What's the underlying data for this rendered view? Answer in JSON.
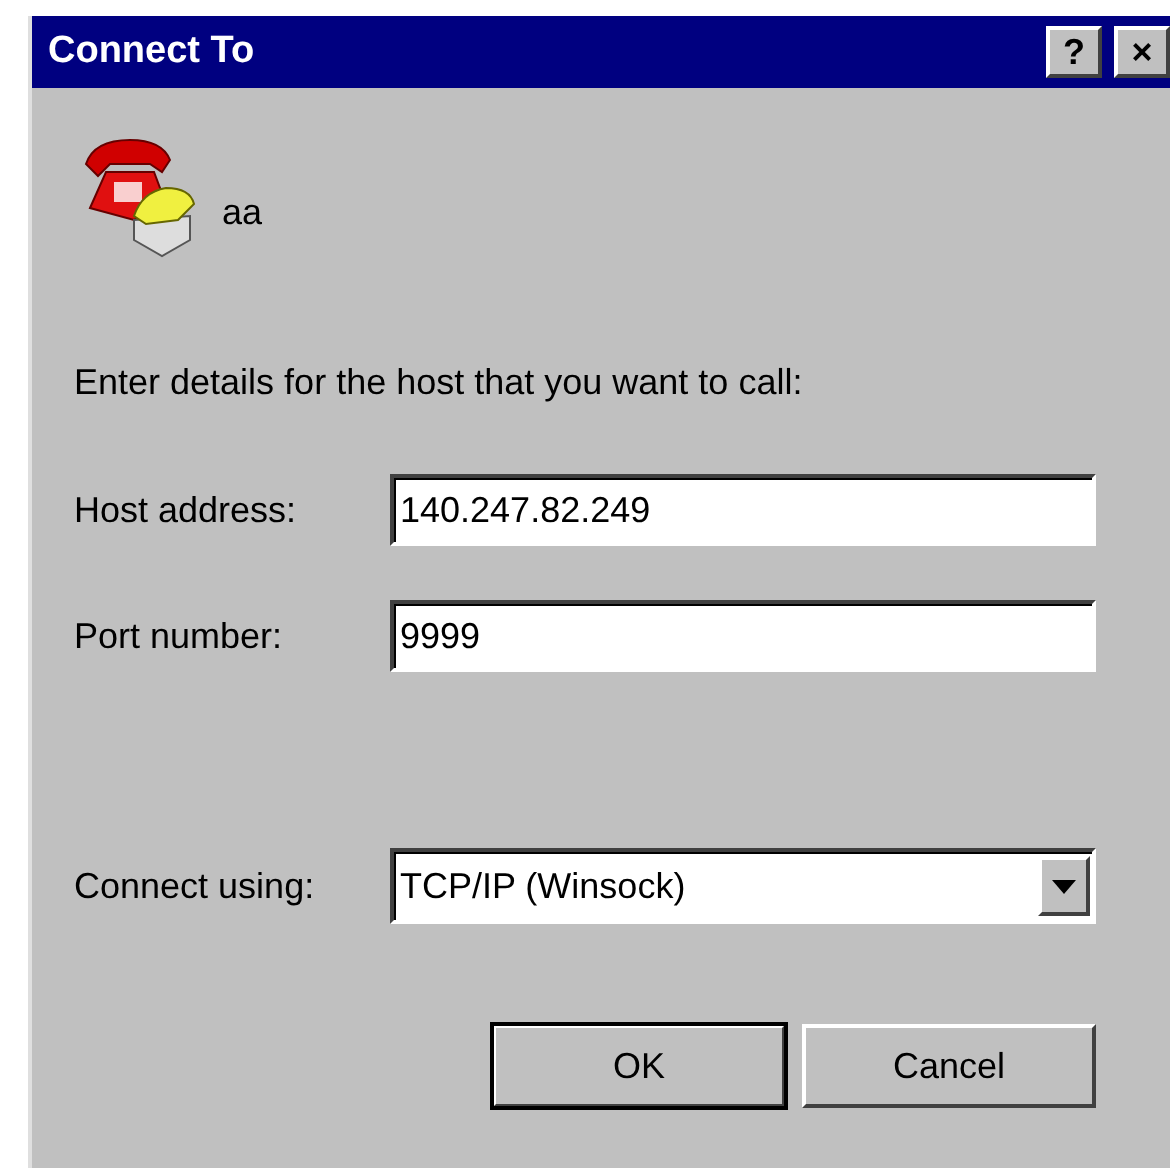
{
  "window": {
    "title": "Connect To",
    "title_buttons": [
      "?",
      "×"
    ]
  },
  "connection": {
    "name": "aa"
  },
  "prompt": "Enter details for the host that you want to call:",
  "fields": [
    {
      "label": "Host address:",
      "value": "140.247.82.249"
    },
    {
      "label": "Port number:",
      "value": "9999"
    }
  ],
  "connect_using": {
    "label": "Connect using:",
    "value": "TCP/IP (Winsock)"
  },
  "buttons": [
    {
      "label": "OK",
      "default": true
    },
    {
      "label": "Cancel",
      "default": false
    }
  ]
}
